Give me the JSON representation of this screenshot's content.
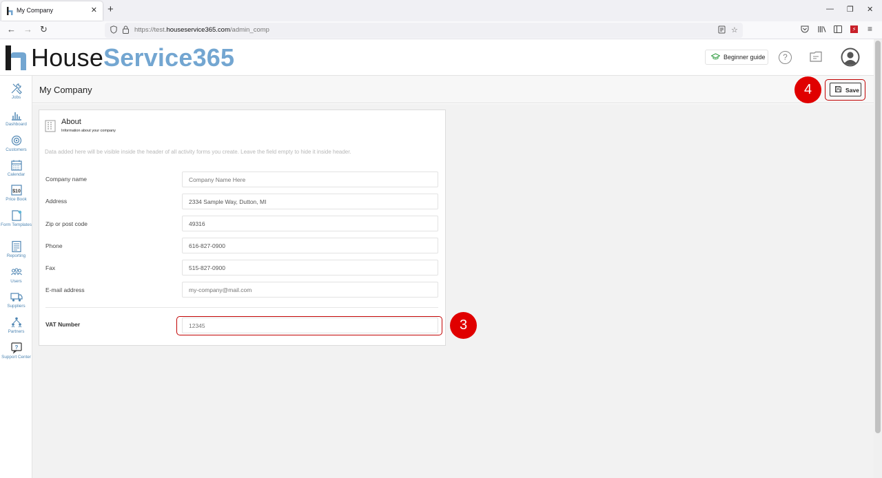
{
  "browser": {
    "tab_title": "My Company",
    "tab_close": "✕",
    "new_tab": "+",
    "window_controls": {
      "minimize": "—",
      "restore": "❐",
      "close": "✕"
    },
    "nav": {
      "back": "←",
      "forward": "→",
      "reload": "↻"
    },
    "url_prefix": "https://test.",
    "url_host": "houseservice365.com",
    "url_path": "/admin_comp"
  },
  "app": {
    "logo_part1": "House",
    "logo_part2": "Service365",
    "beginner_guide": "Beginner guide",
    "help_glyph": "?"
  },
  "sidebar": {
    "items": [
      {
        "label": "Jobs"
      },
      {
        "label": "Dashboard"
      },
      {
        "label": "Customers"
      },
      {
        "label": "Calendar"
      },
      {
        "label": "Price Book"
      },
      {
        "label": "Form Templates"
      },
      {
        "label": "Reporting"
      },
      {
        "label": "Users"
      },
      {
        "label": "Suppliers"
      },
      {
        "label": "Partners"
      },
      {
        "label": "Support Center"
      }
    ]
  },
  "page": {
    "title": "My Company",
    "save_label": "Save"
  },
  "card": {
    "title": "About",
    "subtitle": "Information about your company",
    "note": "Data added here will be visible inside the header of all activity forms you create. Leave the field empty to hide it inside header.",
    "fields": [
      {
        "label": "Company name",
        "value": "",
        "placeholder": "Company Name Here"
      },
      {
        "label": "Address",
        "value": "2334 Sample Way, Dutton, MI",
        "placeholder": ""
      },
      {
        "label": "Zip or post code",
        "value": "49316",
        "placeholder": ""
      },
      {
        "label": "Phone",
        "value": "616-827-0900",
        "placeholder": ""
      },
      {
        "label": "Fax",
        "value": "515-827-0900",
        "placeholder": ""
      },
      {
        "label": "E-mail address",
        "value": "",
        "placeholder": "my-company@mail.com"
      }
    ],
    "vat_label": "VAT Number",
    "vat_value": "",
    "vat_placeholder": "12345"
  },
  "steps": {
    "vat": "3",
    "save": "4"
  },
  "colors": {
    "brand_blue": "#73a6d1",
    "highlight_red": "#c00000",
    "badge_red": "#e00000",
    "sidebar_label": "#4f86b3"
  }
}
